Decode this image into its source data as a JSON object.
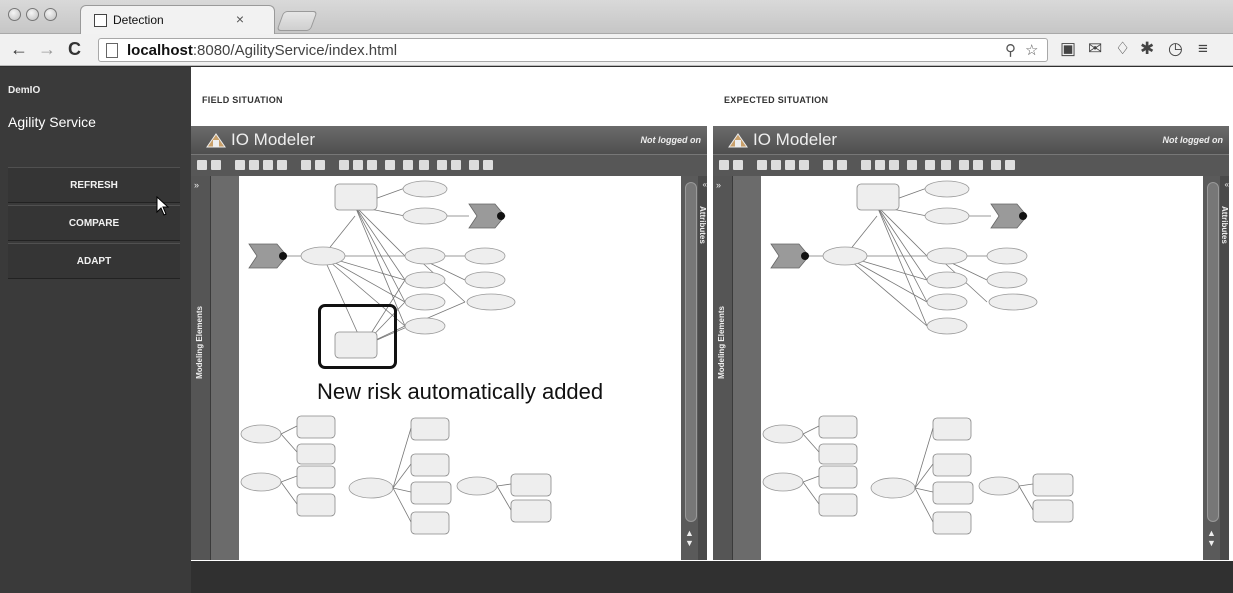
{
  "browser": {
    "tab_title": "Detection",
    "tab_close": "×",
    "nav_back": "←",
    "nav_forward": "→",
    "nav_reload": "C",
    "url_host": "localhost",
    "url_rest": ":8080/AgilityService/index.html",
    "menu_icon": "≡"
  },
  "sidebar": {
    "brand_small": "DemIO",
    "brand_big": "Agility Service",
    "buttons": [
      {
        "label": "REFRESH"
      },
      {
        "label": "COMPARE"
      },
      {
        "label": "ADAPT"
      }
    ]
  },
  "main": {
    "field_label": "FIELD SITUATION",
    "expected_label": "EXPECTED SITUATION",
    "panels": [
      {
        "title": "IO Modeler",
        "login_status": "Not logged on",
        "left_strip": "Modeling Elements",
        "right_strip": "Attributes"
      },
      {
        "title": "IO Modeler",
        "login_status": "Not logged on",
        "left_strip": "Modeling Elements",
        "right_strip": "Attributes"
      }
    ],
    "annotation": "New risk automatically added"
  },
  "colors": {
    "sidebar_bg": "#3a3a3a",
    "panel_header": "#5c5c5c",
    "node_fill": "#eeeeee",
    "highlight": "#111111"
  }
}
